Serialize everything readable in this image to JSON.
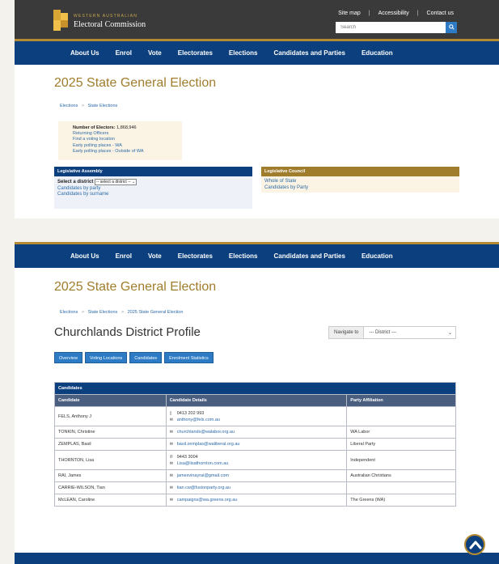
{
  "header": {
    "brand_small": "WESTERN AUSTRALIAN",
    "brand_big": "Electoral Commission",
    "links": [
      "Site map",
      "Accessibility",
      "Contact us"
    ],
    "search_placeholder": "Search"
  },
  "nav": {
    "items": [
      "About Us",
      "Enrol",
      "Vote",
      "Electorates",
      "Elections",
      "Candidates and Parties",
      "Education"
    ]
  },
  "section1": {
    "title": "2025 State General Election",
    "breadcrumb": [
      "Elections",
      "State Elections"
    ],
    "info": {
      "electors_label": "Number of Electors:",
      "electors_value": "1,868,946",
      "links": [
        "Returning Officers",
        "Find a voting location",
        "Early polling places - WA",
        "Early polling places - Outside of WA"
      ]
    },
    "assembly": {
      "title": "Legislative Assembly",
      "select_label": "Select a district",
      "select_value": "-- select a district --",
      "links": [
        "Candidates by party",
        "Candidates by surname"
      ]
    },
    "council": {
      "title": "Legislative Council",
      "links": [
        "Whole of State",
        "Candidates by Party"
      ]
    }
  },
  "section2": {
    "title": "2025 State General Election",
    "breadcrumb": [
      "Elections",
      "State Elections",
      "2025 State General Election"
    ],
    "profile_title": "Churchlands District Profile",
    "navigate_label": "Navigate to",
    "navigate_value": "--- District ---",
    "buttons": [
      "Overview",
      "Voting Locations",
      "Candidates",
      "Enrolment Statistics"
    ],
    "table": {
      "caption": "Candidates",
      "headers": [
        "Candidate",
        "Candidate Details",
        "Party Affiliation"
      ],
      "rows": [
        {
          "name": "FELS, Anthony J",
          "phone": "0413 202 993",
          "email": "anthony@fels.com.au",
          "party": ""
        },
        {
          "name": "TONKIN, Christine",
          "phone": "",
          "email": "churchlands@walabor.org.au",
          "party": "WA Labor"
        },
        {
          "name": "ZEMPLAS, Basil",
          "phone": "",
          "email": "basil.zemplas@waliberal.org.au",
          "party": "Liberal Party"
        },
        {
          "name": "THORNTON, Lisa",
          "phone": "9443 3004",
          "email": "Lisa@lisathornton.com.au",
          "party": "Independent"
        },
        {
          "name": "RAI, James",
          "phone": "",
          "email": "jamesvinayrai@gmail.com",
          "party": "Australian Christians"
        },
        {
          "name": "CARRIE-WILSON, Tian",
          "phone": "",
          "email": "tian.cw@fusionparty.org.au",
          "party": ""
        },
        {
          "name": "McLEAN, Caroline",
          "phone": "",
          "email": "campaigns@wa.greens.org.au",
          "party": "The Greens (WA)"
        }
      ]
    }
  },
  "colors": {
    "nav_blue": "#0b3f7e",
    "gold": "#a07d2c",
    "button_blue": "#2c7bc4"
  }
}
